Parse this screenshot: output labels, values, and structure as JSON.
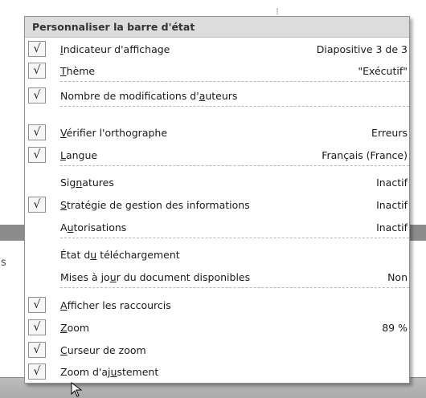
{
  "menu": {
    "title": "Personnaliser la barre d'état",
    "items": [
      {
        "pre": "",
        "key": "I",
        "post": "ndicateur d'affichage",
        "value": "Diapositive 3 de 3",
        "checked": true
      },
      {
        "pre": "",
        "key": "T",
        "post": "hème",
        "value": "\"Exécutif\"",
        "checked": true
      },
      {
        "pre": "Nombre de modifications d'",
        "key": "a",
        "post": "uteurs",
        "value": "",
        "checked": true
      },
      {
        "pre": "",
        "key": "V",
        "post": "érifier l'orthographe",
        "value": "Erreurs",
        "checked": true
      },
      {
        "pre": "",
        "key": "L",
        "post": "angue",
        "value": "Français (France)",
        "checked": true
      },
      {
        "pre": "Sig",
        "key": "n",
        "post": "atures",
        "value": "Inactif",
        "checked": false
      },
      {
        "pre": "",
        "key": "S",
        "post": "tratégie de gestion des informations",
        "value": "Inactif",
        "checked": true
      },
      {
        "pre": "A",
        "key": "u",
        "post": "torisations",
        "value": "Inactif",
        "checked": false
      },
      {
        "pre": "État d",
        "key": "u",
        "post": " téléchargement",
        "value": "",
        "checked": false
      },
      {
        "pre": "Mises à jo",
        "key": "u",
        "post": "r du document disponibles",
        "value": "Non",
        "checked": false
      },
      {
        "pre": "",
        "key": "A",
        "post": "fficher les raccourcis",
        "value": "",
        "checked": true
      },
      {
        "pre": "",
        "key": "Z",
        "post": "oom",
        "value": "89 %",
        "checked": true
      },
      {
        "pre": "",
        "key": "C",
        "post": "urseur de zoom",
        "value": "",
        "checked": true
      },
      {
        "pre": "Zoom d'aj",
        "key": "u",
        "post": "stement",
        "value": "",
        "checked": true
      }
    ]
  },
  "checkmark": "√",
  "background": {
    "partial_text": "s"
  }
}
